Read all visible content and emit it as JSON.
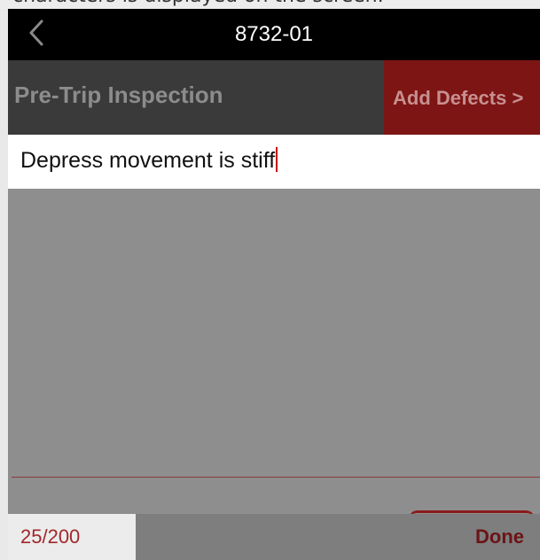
{
  "caption": {
    "text": "characters is displayed on the screen."
  },
  "nav": {
    "title": "8732-01",
    "back_icon": "chevron-left-icon"
  },
  "section": {
    "title": "Pre-Trip Inspection",
    "add_defects_label": "Add Defects >"
  },
  "defect_input": {
    "value": "Depress movement is stiff"
  },
  "footer": {
    "char_count": "25/200",
    "done_label": "Done"
  },
  "colors": {
    "nav_background": "#000000",
    "section_background": "#3a3a3a",
    "accent_red": "#7d1514",
    "overlay_gray": "#8e8e8e",
    "count_text": "#a0282c",
    "caret": "#cc0000"
  }
}
